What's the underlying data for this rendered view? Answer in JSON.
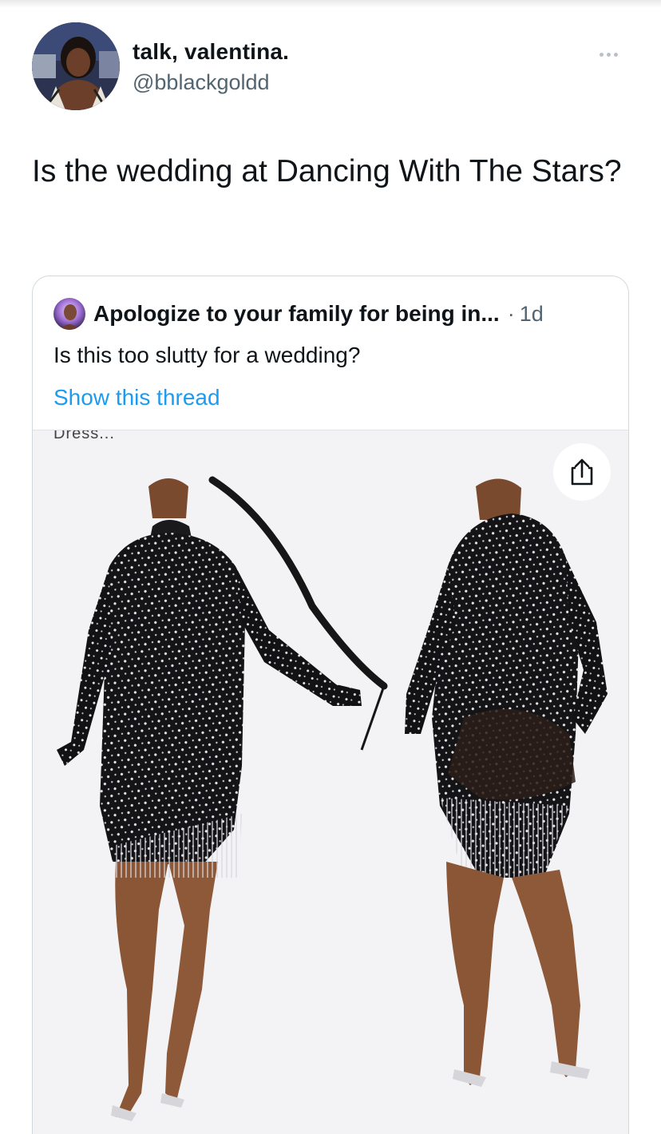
{
  "tweet": {
    "display_name": "talk, valentina.",
    "handle": "@bblackgoldd",
    "text": "Is the wedding at Dancing With The Stars?",
    "more_icon": "more-horizontal-icon"
  },
  "quoted_tweet": {
    "display_name": "Apologize to your family for being in...",
    "separator": "·",
    "time": "1d",
    "text": "Is this too slutty for a wedding?",
    "show_thread_label": "Show this thread",
    "media_caption": "Dress...",
    "share_icon": "share-icon"
  },
  "colors": {
    "text_primary": "#0f1419",
    "text_secondary": "#536471",
    "link": "#1d9bf0",
    "border": "#cfd9de"
  }
}
